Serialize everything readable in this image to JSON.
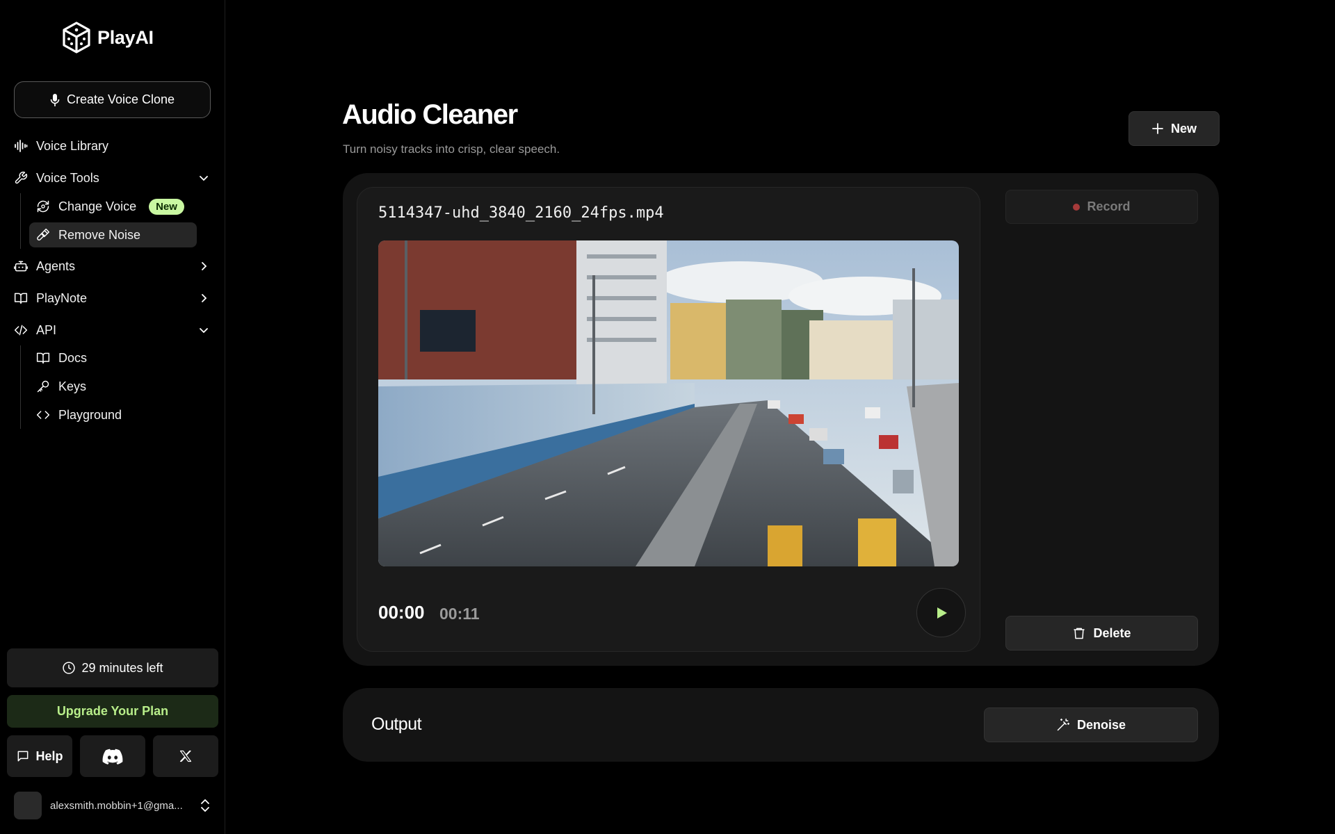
{
  "brand": {
    "name": "PlayAI"
  },
  "sidebar": {
    "create_button": "Create Voice Clone",
    "nav": {
      "voice_library": "Voice Library",
      "voice_tools": "Voice Tools",
      "change_voice": "Change Voice",
      "change_voice_badge": "New",
      "remove_noise": "Remove Noise",
      "agents": "Agents",
      "playnote": "PlayNote",
      "api": "API",
      "docs": "Docs",
      "keys": "Keys",
      "playground": "Playground"
    },
    "minutes_left": "29 minutes left",
    "upgrade": "Upgrade Your Plan",
    "help": "Help",
    "account_email": "alexsmith.mobbin+1@gma..."
  },
  "main": {
    "title": "Audio Cleaner",
    "subtitle": "Turn noisy tracks into crisp, clear speech.",
    "new_button": "New",
    "file": {
      "name": "5114347-uhd_3840_2160_24fps.mp4",
      "current_time": "00:00",
      "total_time": "00:11"
    },
    "record_button": "Record",
    "delete_button": "Delete",
    "output_label": "Output",
    "denoise_button": "Denoise"
  },
  "colors": {
    "accent_green": "#c9f7a1",
    "upgrade_text": "#b8ee8a",
    "record_dot": "#a53a3a"
  }
}
